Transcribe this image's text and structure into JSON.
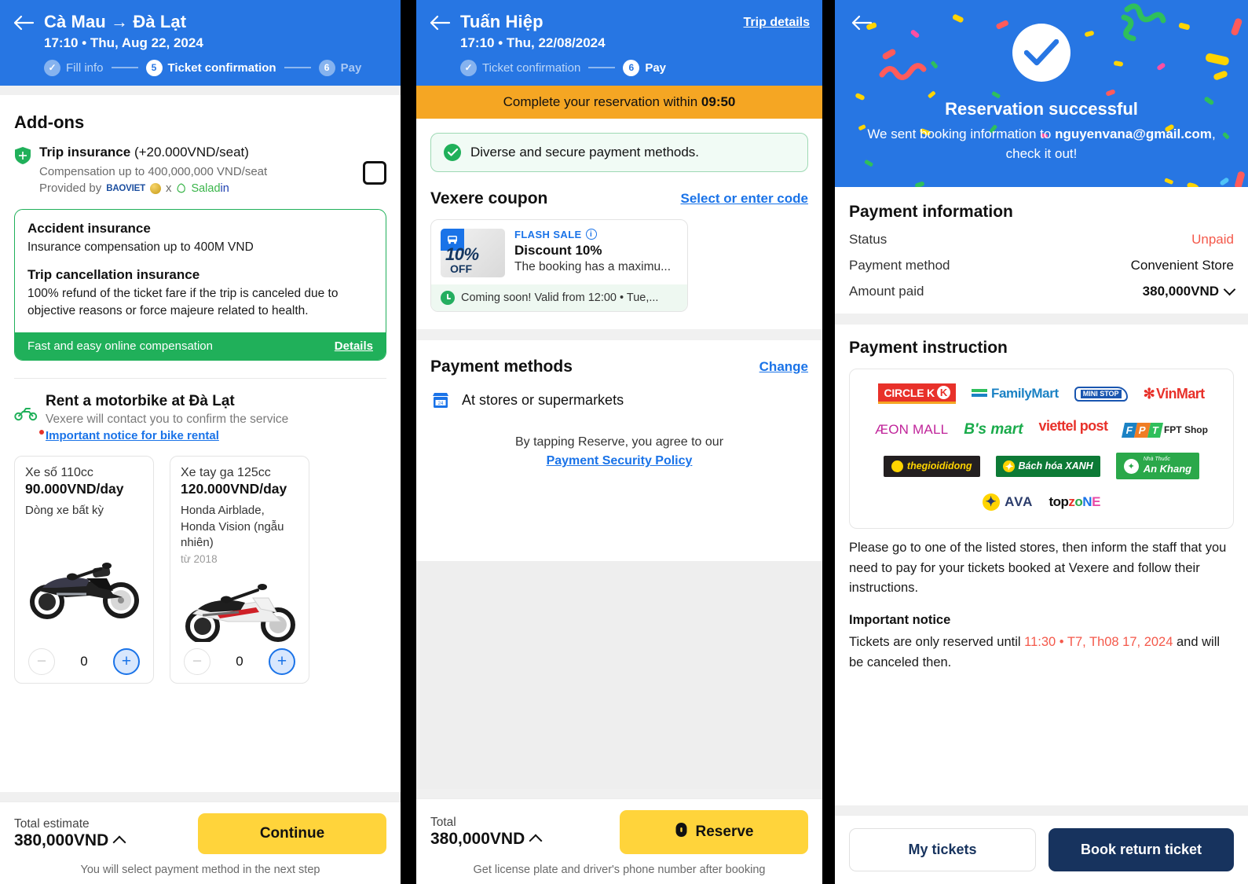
{
  "panel1": {
    "header": {
      "back_icon": "arrow-left-icon",
      "route": "Cà Mau → Đà Lạt",
      "datetime": "17:10 • Thu, Aug 22, 2024",
      "steps": [
        {
          "label": "Fill info",
          "marker": "✓",
          "state": "done"
        },
        {
          "label": "Ticket confirmation",
          "marker": "5",
          "state": "active"
        },
        {
          "label": "Pay",
          "marker": "6",
          "state": "mute"
        }
      ]
    },
    "addons_title": "Add-ons",
    "insurance": {
      "title": "Trip insurance",
      "price": "(+20.000VND/seat)",
      "compensation": "Compensation up to 400,000,000 VND/seat",
      "provided_by": "Provided by",
      "brand_1": "BAOVIET",
      "brand_sep": "x",
      "brand_2a": "Salad",
      "brand_2b": "in",
      "card": {
        "h1": "Accident insurance",
        "p1": "Insurance compensation up to 400M VND",
        "h2": "Trip cancellation insurance",
        "p2": "100% refund of the ticket fare if the trip is canceled due to objective reasons or force majeure related to health.",
        "footer_text": "Fast and easy online compensation",
        "footer_link": "Details"
      }
    },
    "bike": {
      "title": "Rent a motorbike at Đà Lạt",
      "subtitle": "Vexere will contact you to confirm the service",
      "notice": "Important notice for bike rental",
      "cards": [
        {
          "name": "Xe số 110cc",
          "price": "90.000VND/day",
          "desc": "Dòng xe bất kỳ",
          "year": "",
          "qty": "0",
          "minus": "−",
          "plus": "+"
        },
        {
          "name": "Xe tay ga 125cc",
          "price": "120.000VND/day",
          "desc": "Honda Airblade, Honda Vision (ngẫu nhiên)",
          "year": "từ 2018",
          "qty": "0",
          "minus": "−",
          "plus": "+"
        }
      ]
    },
    "footer": {
      "total_label": "Total estimate",
      "total_value": "380,000VND",
      "button": "Continue",
      "note": "You will select payment method in the next step"
    }
  },
  "panel2": {
    "header": {
      "back_icon": "arrow-left-icon",
      "operator": "Tuấn Hiệp",
      "datetime": "17:10 • Thu, 22/08/2024",
      "trip_details": "Trip details",
      "steps": [
        {
          "label": "Ticket confirmation",
          "marker": "✓",
          "state": "done"
        },
        {
          "label": "Pay",
          "marker": "6",
          "state": "active"
        }
      ]
    },
    "timer_prefix": "Complete your reservation within",
    "timer_value": "09:50",
    "secure_banner": "Diverse and secure payment methods.",
    "coupon": {
      "section_title": "Vexere coupon",
      "section_link": "Select or enter code",
      "badge_pct": "10%",
      "badge_off": "OFF",
      "flash": "FLASH SALE",
      "title": "Discount 10%",
      "desc": "The booking has a maximu...",
      "footer": "Coming soon! Valid from 12:00 • Tue,..."
    },
    "payment": {
      "section_title": "Payment methods",
      "section_link": "Change",
      "method": "At stores or supermarkets",
      "agree_text": "By tapping Reserve, you agree to our",
      "agree_link": "Payment Security Policy"
    },
    "footer": {
      "total_label": "Total",
      "total_value": "380,000VND",
      "button": "Reserve",
      "note": "Get license plate and driver's phone number after booking"
    }
  },
  "panel3": {
    "success": {
      "back_icon": "arrow-left-icon",
      "check_icon": "check-circle-icon",
      "title": "Reservation successful",
      "msg_pre": "We sent booking information to ",
      "email": "nguyenvana@gmail.com",
      "msg_post": ", check it out!"
    },
    "payment_information": {
      "title": "Payment information",
      "rows": [
        {
          "key": "Status",
          "value": "Unpaid",
          "style": "red"
        },
        {
          "key": "Payment method",
          "value": "Convenient Store",
          "style": "plain"
        },
        {
          "key": "Amount paid",
          "value": "380,000VND",
          "style": "bold-caret"
        }
      ]
    },
    "payment_instruction": {
      "title": "Payment instruction",
      "stores_row1": [
        "CIRCLE K",
        "FamilyMart",
        "MINI STOP",
        "VinMart"
      ],
      "stores_row2": [
        "ÆON MALL",
        "B's mart",
        "viettel post",
        "FPT Shop"
      ],
      "stores_row3": [
        "thegioididong",
        "Bách hóa XANH",
        "An Khang"
      ],
      "stores_row4": [
        "AVA",
        "topzone"
      ],
      "instruction": "Please go to one of the listed stores, then inform the staff that you need to pay for your tickets booked at Vexere and follow their instructions.",
      "important_title": "Important notice",
      "important_pre": "Tickets are only reserved until ",
      "important_time": "11:30 • T7, Th08 17, 2024",
      "important_post": " and will be canceled then."
    },
    "footer": {
      "my_tickets": "My tickets",
      "book_return": "Book return ticket"
    }
  },
  "colors": {
    "brand_blue": "#2776e3",
    "accent_yellow": "#ffd43b",
    "green": "#20b05a",
    "orange": "#f5a623",
    "red": "#f4594b",
    "navy": "#17335e"
  }
}
